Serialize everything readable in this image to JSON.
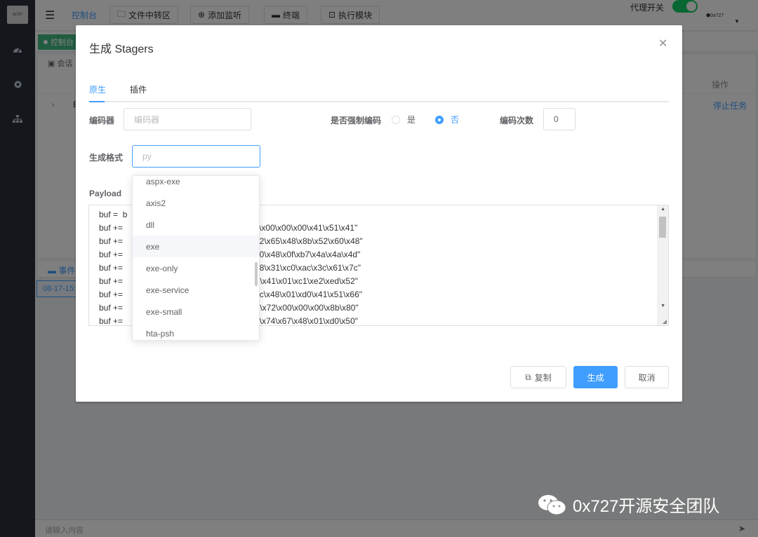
{
  "app": {
    "logo_text": "0x727",
    "breadcrumb": "控制台",
    "toolbar": [
      {
        "label": "文件中转区",
        "icon": "folder-icon"
      },
      {
        "label": "添加监听",
        "icon": "plus-circle-icon"
      },
      {
        "label": "终端",
        "icon": "terminal-icon"
      },
      {
        "label": "执行模块",
        "icon": "module-icon"
      }
    ],
    "proxy_label": "代理开关",
    "proxy_on": true,
    "user_name": "0x727",
    "active_tab": "控制台",
    "session_title": "会话",
    "column_op": "操作",
    "row_cell": "B",
    "stop_task": "停止任务",
    "event_title": "事件",
    "event_time": "08-17-15:",
    "bottom_placeholder": "请输入内容"
  },
  "dialog": {
    "title": "生成 Stagers",
    "tabs": [
      "原生",
      "插件"
    ],
    "active_tab": 0,
    "encoder_label": "编码器",
    "encoder_placeholder": "编码器",
    "force_label": "是否强制编码",
    "force_yes": "是",
    "force_no": "否",
    "force_selected": "否",
    "count_label": "编码次数",
    "count_value": "0",
    "format_label": "生成格式",
    "format_placeholder": "py",
    "payload_label": "Payload",
    "payload_prefix": [
      "buf =  b",
      "buf +=",
      "buf +=",
      "buf +=",
      "buf +=",
      "buf +=",
      "buf +=",
      "buf +=",
      "buf +="
    ],
    "payload_tail": [
      "",
      "cc\\x00\\x00\\x00\\x41\\x51\\x41\"",
      "xd2\\x65\\x48\\x8b\\x52\\x60\\x48\"",
      "x20\\x48\\x0f\\xb7\\x4a\\x4a\\x4d\"",
      "x48\\x31\\xc0\\xac\\x3c\\x61\\x7c\"",
      "0d\\x41\\x01\\xc1\\xe2\\xed\\x52\"",
      "x3c\\x48\\x01\\xd0\\x41\\x51\\x66\"",
      "85\\x72\\x00\\x00\\x00\\x8b\\x80\"",
      "c0\\x74\\x67\\x48\\x01\\xd0\\x50\""
    ],
    "copy_label": "复制",
    "generate_label": "生成",
    "cancel_label": "取消"
  },
  "format_dropdown": {
    "options": [
      "aspx-exe",
      "axis2",
      "dll",
      "exe",
      "exe-only",
      "exe-service",
      "exe-small",
      "hta-psh"
    ],
    "hovered": "exe"
  },
  "watermark": "0x727开源安全团队",
  "colors": {
    "primary": "#409eff",
    "switch_on": "#13ce66",
    "sidebar": "#2b2f3a",
    "tab_active": "#42b983"
  }
}
